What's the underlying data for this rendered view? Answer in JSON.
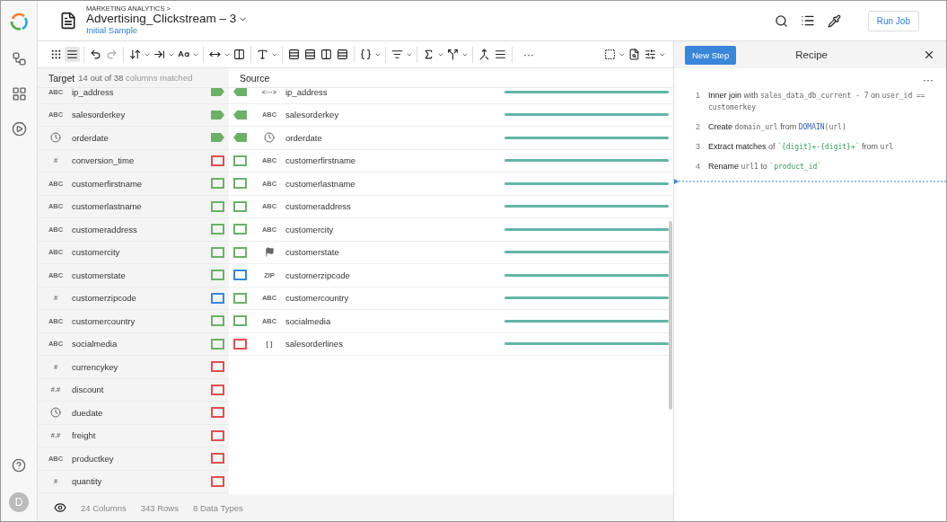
{
  "rail": {
    "avatar": "D"
  },
  "header": {
    "breadcrumb": "MARKETING ANALYTICS >",
    "title": "Advertising_Clickstream – 3",
    "sample": "Initial Sample",
    "run_button": "Run Job"
  },
  "toolbar": {
    "view_buttons": [
      {
        "selected": false
      },
      {
        "selected": true
      }
    ],
    "more": "···"
  },
  "match_panel": {
    "target_label": "Target",
    "target_summary": "**14 out of 38** columns matched",
    "source_label": "Source",
    "target_rows": [
      {
        "name": "ip_address",
        "type": {
          "kind": "text",
          "label": "ABC"
        },
        "tag": {
          "kind": "filled",
          "color": "#6cb068"
        }
      },
      {
        "name": "salesorderkey",
        "type": {
          "kind": "text",
          "label": "ABC"
        },
        "tag": {
          "kind": "filled",
          "color": "#6cb068"
        }
      },
      {
        "name": "orderdate",
        "type": {
          "kind": "clock"
        },
        "tag": {
          "kind": "filled",
          "color": "#6cb068"
        }
      },
      {
        "name": "conversion_time",
        "type": {
          "kind": "text",
          "label": "#"
        },
        "tag": {
          "kind": "outline",
          "color": "#dd5050"
        }
      },
      {
        "name": "customerfirstname",
        "type": {
          "kind": "text",
          "label": "ABC"
        },
        "tag": {
          "kind": "outline",
          "color": "#6cb068"
        }
      },
      {
        "name": "customerlastname",
        "type": {
          "kind": "text",
          "label": "ABC"
        },
        "tag": {
          "kind": "outline",
          "color": "#6cb068"
        }
      },
      {
        "name": "customeraddress",
        "type": {
          "kind": "text",
          "label": "ABC"
        },
        "tag": {
          "kind": "outline",
          "color": "#6cb068"
        }
      },
      {
        "name": "customercity",
        "type": {
          "kind": "text",
          "label": "ABC"
        },
        "tag": {
          "kind": "outline",
          "color": "#6cb068"
        }
      },
      {
        "name": "customerstate",
        "type": {
          "kind": "text",
          "label": "ABC"
        },
        "tag": {
          "kind": "outline",
          "color": "#6cb068"
        }
      },
      {
        "name": "customerzipcode",
        "type": {
          "kind": "text",
          "label": "#"
        },
        "tag": {
          "kind": "outline",
          "color": "#3a86d8"
        }
      },
      {
        "name": "customercountry",
        "type": {
          "kind": "text",
          "label": "ABC"
        },
        "tag": {
          "kind": "outline",
          "color": "#6cb068"
        }
      },
      {
        "name": "socialmedia",
        "type": {
          "kind": "text",
          "label": "ABC"
        },
        "tag": {
          "kind": "outline",
          "color": "#6cb068"
        }
      },
      {
        "name": "currencykey",
        "type": {
          "kind": "text",
          "label": "#"
        },
        "tag": {
          "kind": "outline",
          "color": "#dd5050"
        }
      },
      {
        "name": "discount",
        "type": {
          "kind": "text",
          "label": "#.#"
        },
        "tag": {
          "kind": "outline",
          "color": "#dd5050"
        }
      },
      {
        "name": "duedate",
        "type": {
          "kind": "clock"
        },
        "tag": {
          "kind": "outline",
          "color": "#dd5050"
        }
      },
      {
        "name": "freight",
        "type": {
          "kind": "text",
          "label": "#.#"
        },
        "tag": {
          "kind": "outline",
          "color": "#dd5050"
        }
      },
      {
        "name": "productkey",
        "type": {
          "kind": "text",
          "label": "ABC"
        },
        "tag": {
          "kind": "outline",
          "color": "#dd5050"
        }
      },
      {
        "name": "quantity",
        "type": {
          "kind": "text",
          "label": "#"
        },
        "tag": {
          "kind": "outline",
          "color": "#dd5050"
        }
      }
    ],
    "source_rows": [
      {
        "name": "ip_address",
        "type": {
          "kind": "text",
          "label": "<···>"
        },
        "tag": {
          "kind": "filled",
          "color": "#6cb068"
        }
      },
      {
        "name": "salesorderkey",
        "type": {
          "kind": "text",
          "label": "ABC"
        },
        "tag": {
          "kind": "filled",
          "color": "#6cb068"
        }
      },
      {
        "name": "orderdate",
        "type": {
          "kind": "clock"
        },
        "tag": {
          "kind": "filled",
          "color": "#6cb068"
        }
      },
      {
        "name": "customerfirstname",
        "type": {
          "kind": "text",
          "label": "ABC"
        },
        "tag": {
          "kind": "outline",
          "color": "#6cb068"
        }
      },
      {
        "name": "customerlastname",
        "type": {
          "kind": "text",
          "label": "ABC"
        },
        "tag": {
          "kind": "outline",
          "color": "#6cb068"
        }
      },
      {
        "name": "customeraddress",
        "type": {
          "kind": "text",
          "label": "ABC"
        },
        "tag": {
          "kind": "outline",
          "color": "#6cb068"
        }
      },
      {
        "name": "customercity",
        "type": {
          "kind": "text",
          "label": "ABC"
        },
        "tag": {
          "kind": "outline",
          "color": "#6cb068"
        }
      },
      {
        "name": "customerstate",
        "type": {
          "kind": "flag"
        },
        "tag": {
          "kind": "outline",
          "color": "#6cb068"
        }
      },
      {
        "name": "customerzipcode",
        "type": {
          "kind": "text",
          "label": "ZIP"
        },
        "tag": {
          "kind": "outline",
          "color": "#3a86d8"
        }
      },
      {
        "name": "customercountry",
        "type": {
          "kind": "text",
          "label": "ABC"
        },
        "tag": {
          "kind": "outline",
          "color": "#6cb068"
        }
      },
      {
        "name": "socialmedia",
        "type": {
          "kind": "text",
          "label": "ABC"
        },
        "tag": {
          "kind": "outline",
          "color": "#6cb068"
        }
      },
      {
        "name": "salesorderlines",
        "type": {
          "kind": "text",
          "label": "[ ]"
        },
        "tag": {
          "kind": "outline",
          "color": "#dd5050"
        }
      }
    ]
  },
  "footer": [
    "24 Columns",
    "343 Rows",
    "8 Data Types"
  ],
  "recipe": {
    "new_step": "New Step",
    "title": "Recipe",
    "more": "···",
    "steps": [
      {
        "number": "1",
        "parts": [
          {
            "kind": "verb",
            "text": "Inner join"
          },
          {
            "kind": "text",
            "text": " with "
          },
          {
            "kind": "code",
            "text": "sales_data_db_current - 7"
          },
          {
            "kind": "text",
            "text": " on "
          },
          {
            "kind": "code",
            "text": "user_id == customerkey"
          }
        ]
      },
      {
        "number": "2",
        "parts": [
          {
            "kind": "verb",
            "text": "Create "
          },
          {
            "kind": "code",
            "text": "domain_url"
          },
          {
            "kind": "text",
            "text": " from "
          },
          {
            "kind": "func",
            "text": "DOMAIN"
          },
          {
            "kind": "code",
            "text": "(url)"
          }
        ]
      },
      {
        "number": "3",
        "parts": [
          {
            "kind": "verb",
            "text": "Extract matches"
          },
          {
            "kind": "text",
            "text": " of "
          },
          {
            "kind": "string",
            "text": "`{digit}+-{digit}+`"
          },
          {
            "kind": "text",
            "text": " from "
          },
          {
            "kind": "code",
            "text": "url"
          }
        ]
      },
      {
        "number": "4",
        "parts": [
          {
            "kind": "verb",
            "text": "Rename "
          },
          {
            "kind": "code",
            "text": "url1"
          },
          {
            "kind": "text",
            "text": " to "
          },
          {
            "kind": "string",
            "text": "`product_id`"
          }
        ]
      }
    ]
  }
}
